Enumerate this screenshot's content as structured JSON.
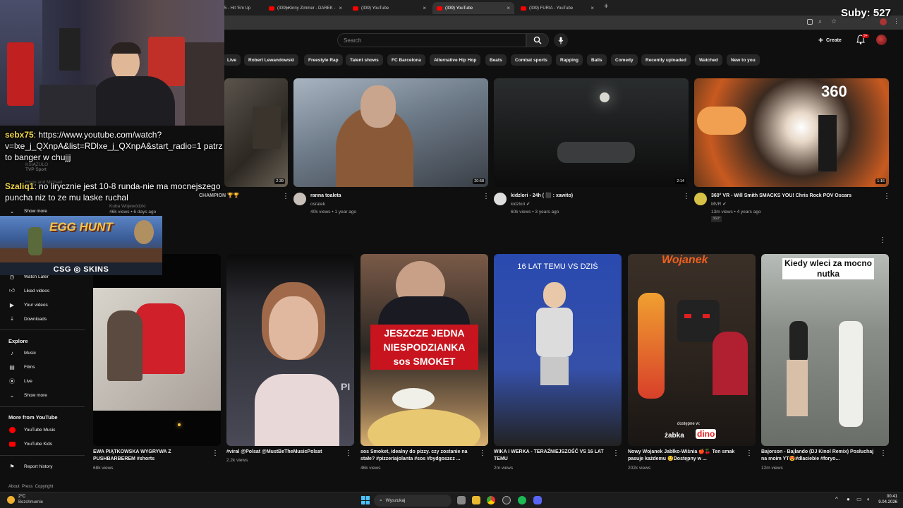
{
  "tabs": [
    {
      "label": "5 - Hit 'Em Up",
      "active": false
    },
    {
      "label": "(339) Kinny Zimmer - DAREK -",
      "active": false
    },
    {
      "label": "(339) YouTube",
      "active": false
    },
    {
      "label": "(339) YouTube",
      "active": true
    },
    {
      "label": "(339) FURIA - YouTube",
      "active": false
    }
  ],
  "search": {
    "placeholder": "Search"
  },
  "header": {
    "create_label": "Create",
    "notif_badge": "9+"
  },
  "chips": [
    "Live",
    "Robert Lewandowski",
    "Freestyle Rap",
    "Talent shows",
    "FC Barcelona",
    "Alternative Hip Hop",
    "Beats",
    "Combat sports",
    "Rapping",
    "Balls",
    "Comedy",
    "Recently uploaded",
    "Watched",
    "New to you"
  ],
  "row1": [
    {
      "duration": "2:39"
    },
    {
      "title": "ranna toaleta",
      "channel": "osralek",
      "meta": "40k views • 1 year ago",
      "duration": "20:58"
    },
    {
      "title": "kidzlori - 24h ( ⬛ : xawito)",
      "channel": "kidzlori ✔",
      "meta": "60k views • 3 years ago",
      "duration": "2:14"
    },
    {
      "title": "360° VR - Will Smith SMACKS YOU! Chris Rock POV Oscars",
      "channel": "MVR ✔",
      "meta": "13m views • 4 years ago",
      "badge": "360°",
      "duration": "1:16"
    }
  ],
  "row1_partial": {
    "title_tail": "CHAMPION 🏆🏆",
    "channel": "Kuba Wojewódzki",
    "meta": "46k views • 6 days ago"
  },
  "shorts": [
    {
      "title": "EWA PIĄTKOWSKA WYGRYWA Z PUSHBARBEREM #shorts",
      "views": "68k views"
    },
    {
      "title": "#viral @Polsat @MustBeTheMusicPolsat",
      "views": "2.2k views"
    },
    {
      "title": "sos Smoket, idealny do pizzy. czy zostanie na stałe? #pizzeriajolanta #sos #bydgoszcz ...",
      "views": "46k views"
    },
    {
      "title": "WIKA I WERKA - TERAŹNIEJSZOŚĆ VS 16 LAT TEMU",
      "views": "2m views"
    },
    {
      "title": "Nowy Wojanek Jabłko-Wiśnia 🍎🍒 Ten smak pasuje każdemu 😊Dostępny w ...",
      "views": "202k views"
    },
    {
      "title": "Bajorson - Bajlando (DJ Kinol Remix) Posłuchaj na moim YT😍#dlaciebie #foryo...",
      "views": "12m views"
    }
  ],
  "shorts_text": {
    "sos1": "JESZCZE JEDNA",
    "sos2": "NIESPODZIANKA",
    "sos3": "sos SMOKET",
    "wika": "16 LAT TEMU VS DZIŚ",
    "kiedy": "Kiedy wleci za mocno nutka",
    "zabka": "dostępne w:",
    "zabka2": "żabka",
    "dino": "dino",
    "wojanek": "Wojanek",
    "pp": "PI"
  },
  "sidebar": {
    "faded": [
      "KSIĄŻULO",
      "TVP Sport",
      "Hugo and Michael"
    ],
    "show_more_top": "Show more",
    "you_items": [
      "Watch Later",
      "Liked videos",
      "Your videos",
      "Downloads"
    ],
    "explore_title": "Explore",
    "explore_items": [
      "Music",
      "Films",
      "Live"
    ],
    "show_more": "Show more",
    "more_title": "More from YouTube",
    "more_items": [
      "YouTube Music",
      "YouTube Kids"
    ],
    "report": "Report history",
    "footer": "About  Press  Copyright"
  },
  "overlay": {
    "subs": "Suby: 527",
    "chat": [
      {
        "name": "sebx75",
        "text": ": https://www.youtube.com/watch?v=lxe_j_QXnpA&list=RDlxe_j_QXnpA&start_radio=1 patrz to banger w chujjj"
      },
      {
        "name": "Szaliq1",
        "text": ": no lirycznie jest 10-8 runda-nie ma mocnejszego puncha niz to ze mu laske ruchal"
      }
    ],
    "egg": "EGG HUNT",
    "csg": "CSG ◎ SKINS"
  },
  "taskbar": {
    "weather_temp": "2°C",
    "weather_desc": "Bezchmurnie",
    "search": "Wyszukaj",
    "time": "00:41",
    "date": "9.04.2026"
  },
  "colors": {
    "bg": "#0f0f0f",
    "chip": "#272727",
    "accent": "#ff0000"
  }
}
